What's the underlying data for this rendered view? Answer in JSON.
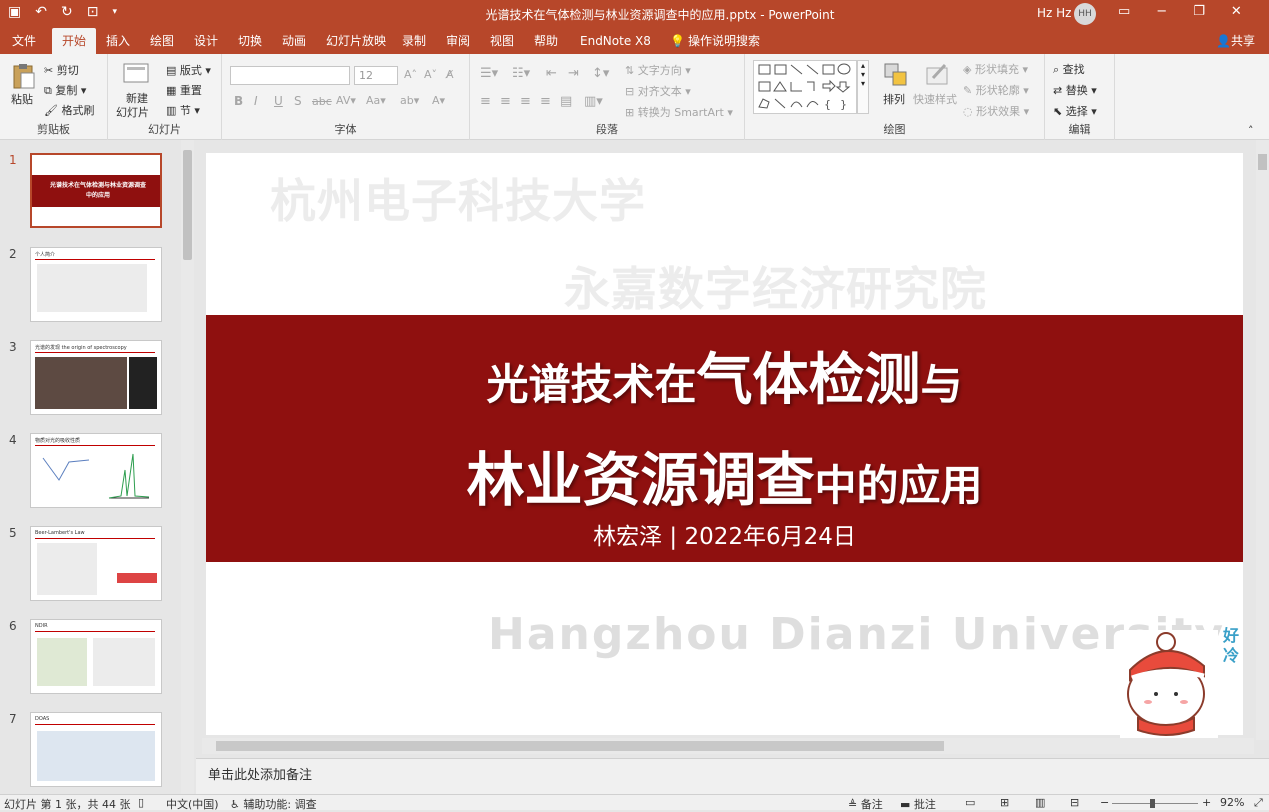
{
  "app": {
    "doc_title": "光谱技术在气体检测与林业资源调查中的应用.pptx - PowerPoint",
    "user_name": "Hz Hz",
    "user_initials": "HH"
  },
  "tabs": [
    "文件",
    "开始",
    "插入",
    "绘图",
    "设计",
    "切换",
    "动画",
    "幻灯片放映",
    "录制",
    "审阅",
    "视图",
    "帮助",
    "EndNote X8",
    "操作说明搜索"
  ],
  "share_label": "共享",
  "ribbon": {
    "clipboard": {
      "paste": "粘贴",
      "cut": "剪切",
      "copy": "复制",
      "format_painter": "格式刷",
      "group": "剪贴板"
    },
    "slides": {
      "new_slide_1": "新建",
      "new_slide_2": "幻灯片",
      "layout": "版式",
      "reset": "重置",
      "section": "节",
      "group": "幻灯片"
    },
    "font": {
      "size": "12",
      "group": "字体"
    },
    "paragraph": {
      "text_direction": "文字方向",
      "align_text": "对齐文本",
      "smartart": "转换为 SmartArt",
      "group": "段落"
    },
    "drawing": {
      "arrange": "排列",
      "quick_styles": "快速样式",
      "shape_fill": "形状填充",
      "shape_outline": "形状轮廓",
      "shape_effects": "形状效果",
      "group": "绘图"
    },
    "editing": {
      "find": "查找",
      "replace": "替换",
      "select": "选择",
      "group": "编辑"
    }
  },
  "thumbnails": [
    {
      "num": "1",
      "title": "光谱技术在气体检测与林业资源调查中的应用"
    },
    {
      "num": "2",
      "title": "个人简介"
    },
    {
      "num": "3",
      "title": "光谱的发现 the origin of spectroscopy"
    },
    {
      "num": "4",
      "title": "物质对光的吸收性质"
    },
    {
      "num": "5",
      "title": "Beer-Lambert's Law"
    },
    {
      "num": "6",
      "title": "NDIR"
    },
    {
      "num": "7",
      "title": "DOAS"
    }
  ],
  "slide": {
    "watermark_1": "杭州电子科技大学",
    "watermark_2": "永嘉数字经济研究院",
    "watermark_3": "Hangzhou Dianzi University",
    "title_line1_small": "光谱技术在",
    "title_line1_big": "气体检测",
    "title_line1_end": "与",
    "title_line2_big": "林业资源调查",
    "title_line2_small": "中的应用",
    "subtitle": "林宏泽 | 2022年6月24日",
    "sticker_text": "好冷"
  },
  "notes_placeholder": "单击此处添加备注",
  "status": {
    "slide_info": "幻灯片 第 1 张，共 44 张",
    "language": "中文(中国)",
    "accessibility": "辅助功能: 调查",
    "notes": "备注",
    "comments": "批注",
    "zoom": "92%"
  },
  "colors": {
    "accent": "#b7472a",
    "band": "#8f100f"
  }
}
